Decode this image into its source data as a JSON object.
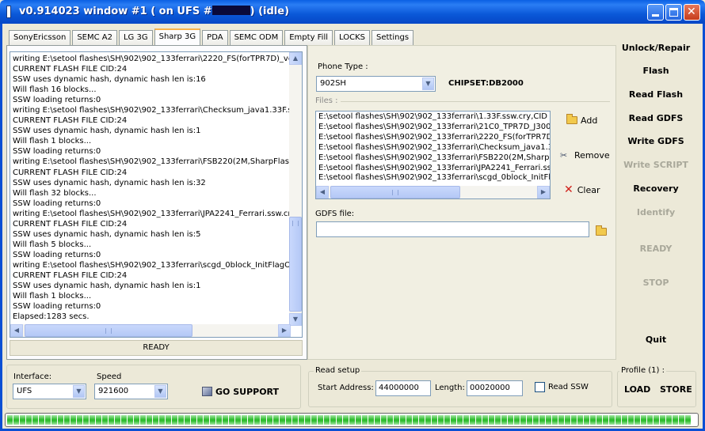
{
  "window": {
    "title_prefix": "v0.914023 window #1 ( on UFS #",
    "title_suffix": ") (idle)"
  },
  "tabs": [
    "SonyEricsson",
    "SEMC A2",
    "LG 3G",
    "Sharp 3G",
    "PDA",
    "SEMC ODM",
    "Empty Fill",
    "LOCKS",
    "Settings"
  ],
  "active_tab": "Sharp 3G",
  "log": [
    "writing E:\\setool flashes\\SH\\902\\902_133ferrari\\2220_FS(forTPR7D)_ver",
    "CURRENT FLASH FILE CID:24",
    "SSW uses dynamic hash, dynamic hash len is:16",
    "Will flash 16 blocks...",
    "SSW loading returns:0",
    "writing E:\\setool flashes\\SH\\902\\902_133ferrari\\Checksum_java1.33F.ss",
    "CURRENT FLASH FILE CID:24",
    "SSW uses dynamic hash, dynamic hash len is:1",
    "Will flash 1 blocks...",
    "SSW loading returns:0",
    "writing E:\\setool flashes\\SH\\902\\902_133ferrari\\FSB220(2M,SharpFlash)",
    "CURRENT FLASH FILE CID:24",
    "SSW uses dynamic hash, dynamic hash len is:32",
    "Will flash 32 blocks...",
    "SSW loading returns:0",
    "writing E:\\setool flashes\\SH\\902\\902_133ferrari\\JPA2241_Ferrari.ssw.cr",
    "CURRENT FLASH FILE CID:24",
    "SSW uses dynamic hash, dynamic hash len is:5",
    "Will flash 5 blocks...",
    "SSW loading returns:0",
    "writing E:\\setool flashes\\SH\\902\\902_133ferrari\\scgd_0block_InitFlagOn",
    "CURRENT FLASH FILE CID:24",
    "SSW uses dynamic hash, dynamic hash len is:1",
    "Will flash 1 blocks...",
    "SSW loading returns:0",
    "Elapsed:1283 secs."
  ],
  "left_status": "READY",
  "phone_type": {
    "label": "Phone Type :",
    "value": "902SH"
  },
  "chipset": "CHIPSET:DB2000",
  "files": {
    "label": "Files :",
    "items": [
      "E:\\setool flashes\\SH\\902\\902_133ferrari\\1.33F.ssw.cry,CID",
      "E:\\setool flashes\\SH\\902\\902_133ferrari\\21C0_TPR7D_J300",
      "E:\\setool flashes\\SH\\902\\902_133ferrari\\2220_FS(forTPR7D",
      "E:\\setool flashes\\SH\\902\\902_133ferrari\\Checksum_java1.3",
      "E:\\setool flashes\\SH\\902\\902_133ferrari\\FSB220(2M,SharpF",
      "E:\\setool flashes\\SH\\902\\902_133ferrari\\JPA2241_Ferrari.ss",
      "E:\\setool flashes\\SH\\902\\902_133ferrari\\scgd_0block_InitFla"
    ]
  },
  "file_buttons": {
    "add": "Add",
    "remove": "Remove",
    "clear": "Clear"
  },
  "gdfs": {
    "label": "GDFS file:",
    "value": ""
  },
  "commands": {
    "unlock": "Unlock/Repair",
    "flash": "Flash",
    "read_flash": "Read Flash",
    "read_gdfs": "Read GDFS",
    "write_gdfs": "Write GDFS",
    "write_script": "Write SCRIPT",
    "recovery": "Recovery",
    "identify": "Identify",
    "ready": "READY",
    "stop": "STOP",
    "quit": "Quit"
  },
  "interface": {
    "label": "Interface:",
    "value": "UFS"
  },
  "speed": {
    "label": "Speed",
    "value": "921600"
  },
  "go_support": "GO SUPPORT",
  "read_setup": {
    "title": "Read setup",
    "start_label": "Start Address:",
    "start_value": "44000000",
    "length_label": "Length:",
    "length_value": "00020000",
    "read_ssw_label": "Read SSW",
    "read_ssw_checked": false
  },
  "profile": {
    "title": "Profile (1) :",
    "load": "LOAD",
    "store": "STORE"
  },
  "progress": {
    "percent": 100,
    "color": "#2fbd2f"
  }
}
